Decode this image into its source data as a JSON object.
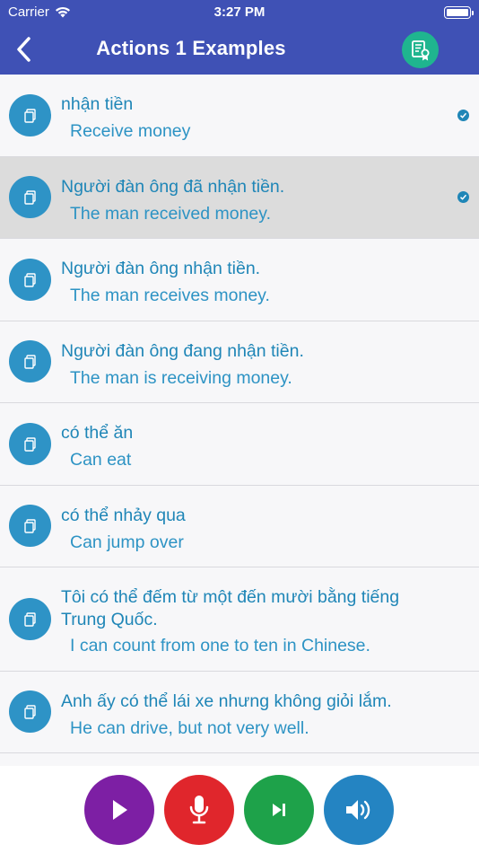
{
  "status_bar": {
    "carrier": "Carrier",
    "time": "3:27 PM"
  },
  "nav": {
    "title": "Actions 1 Examples",
    "cert_button_color": "#1fb58f"
  },
  "examples": [
    {
      "vietnamese": "nhận tiền",
      "english": "Receive money",
      "checked": true,
      "selected": false
    },
    {
      "vietnamese": "Người đàn ông đã nhận tiền.",
      "english": "The man received money.",
      "checked": true,
      "selected": true
    },
    {
      "vietnamese": "Người đàn ông nhận tiền.",
      "english": "The man receives money.",
      "checked": false,
      "selected": false
    },
    {
      "vietnamese": "Người đàn ông đang nhận tiền.",
      "english": "The man is receiving money.",
      "checked": false,
      "selected": false
    },
    {
      "vietnamese": "có thể ăn",
      "english": "Can eat",
      "checked": false,
      "selected": false
    },
    {
      "vietnamese": "có thể nhảy qua",
      "english": "Can jump over",
      "checked": false,
      "selected": false
    },
    {
      "vietnamese": "Tôi có thể đếm từ một đến mười bằng tiếng Trung Quốc.",
      "english": "I can count from one to ten in Chinese.",
      "checked": false,
      "selected": false
    },
    {
      "vietnamese": "Anh ấy có thể lái xe nhưng không giỏi lắm.",
      "english": "He can drive, but not very well.",
      "checked": false,
      "selected": false
    }
  ],
  "controls": {
    "play_color": "#7d1fa4",
    "mic_color": "#e0262c",
    "next_color": "#1ea24a",
    "sound_color": "#2484c2"
  },
  "colors": {
    "header": "#3f51b5",
    "text": "#1f86b7",
    "selected_row": "#dcdcdc"
  }
}
